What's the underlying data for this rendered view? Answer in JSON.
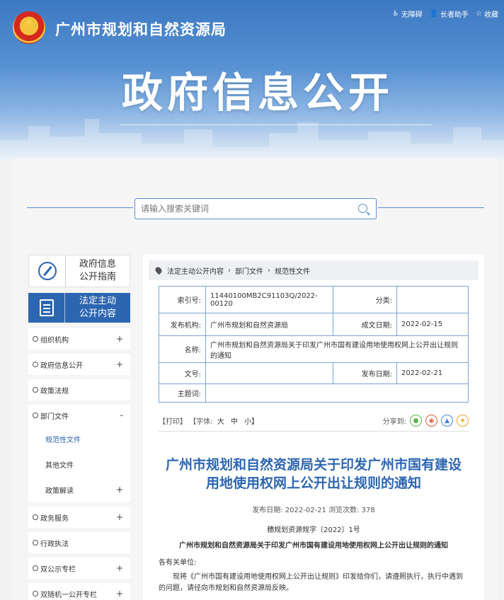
{
  "header": {
    "site_title": "广州市规划和自然资源局",
    "banner_title": "政府信息公开",
    "links": [
      "无障碍",
      "长者助手",
      "收藏"
    ]
  },
  "search": {
    "placeholder": "请输入搜索关键词"
  },
  "sidebar": {
    "guide": "政府信息\n公开指南",
    "guide_l1": "政府信息",
    "guide_l2": "公开指南",
    "statutory_l1": "法定主动",
    "statutory_l2": "公开内容",
    "items": [
      {
        "label": "组织机构",
        "toggle": "+"
      },
      {
        "label": "政府信息公开",
        "toggle": "+"
      },
      {
        "label": "政策法规",
        "toggle": ""
      },
      {
        "label": "部门文件",
        "toggle": "-"
      },
      {
        "label": "政务服务",
        "toggle": "+"
      },
      {
        "label": "行政执法",
        "toggle": ""
      },
      {
        "label": "双公示专栏",
        "toggle": "+"
      },
      {
        "label": "双随机一公开专栏",
        "toggle": "+"
      }
    ],
    "sub_items": [
      {
        "label": "规范性文件",
        "toggle": ""
      },
      {
        "label": "其他文件",
        "toggle": ""
      },
      {
        "label": "政策解读",
        "toggle": "+"
      }
    ]
  },
  "breadcrumb": [
    "法定主动公开内容",
    "部门文件",
    "规范性文件"
  ],
  "meta": {
    "index_label": "索引号:",
    "index_value": "11440100MB2C91103Q/2022-00120",
    "category_label": "分类:",
    "category_value": "",
    "org_label": "发布机构:",
    "org_value": "广州市规划和自然资源局",
    "made_label": "成文日期:",
    "made_value": "2022-02-15",
    "name_label": "名称:",
    "name_value": "广州市规划和自然资源局关于印发广州市国有建设用地使用权网上公开出让规则的通知",
    "docno_label": "文号:",
    "docno_value": "",
    "pub_label": "发布日期:",
    "pub_value": "2022-02-21",
    "subject_label": "主题词:",
    "subject_value": ""
  },
  "tools": {
    "print": "【打印】",
    "font_label": "【字体:",
    "font_large": "大",
    "font_mid": "中",
    "font_small": "小】",
    "share_label": "分享到:"
  },
  "article": {
    "title_l1": "广州市规划和自然资源局关于印发广州市国有建设",
    "title_l2": "用地使用权网上公开出让规则的通知",
    "pubinfo": "发布日期: 2022-02-21  浏览次数: 378",
    "docno": "穗规划资源规字〔2022〕1号",
    "subtitle": "广州市规划和自然资源局关于印发广州市国有建设用地使用权网上公开出让规则的通知",
    "salutation": "各有关单位:",
    "body": "现将《广州市国有建设用地使用权网上公开出让规则》印发给你们，请遵照执行，执行中遇到的问题，请径向市规划和自然资源局反映。"
  }
}
